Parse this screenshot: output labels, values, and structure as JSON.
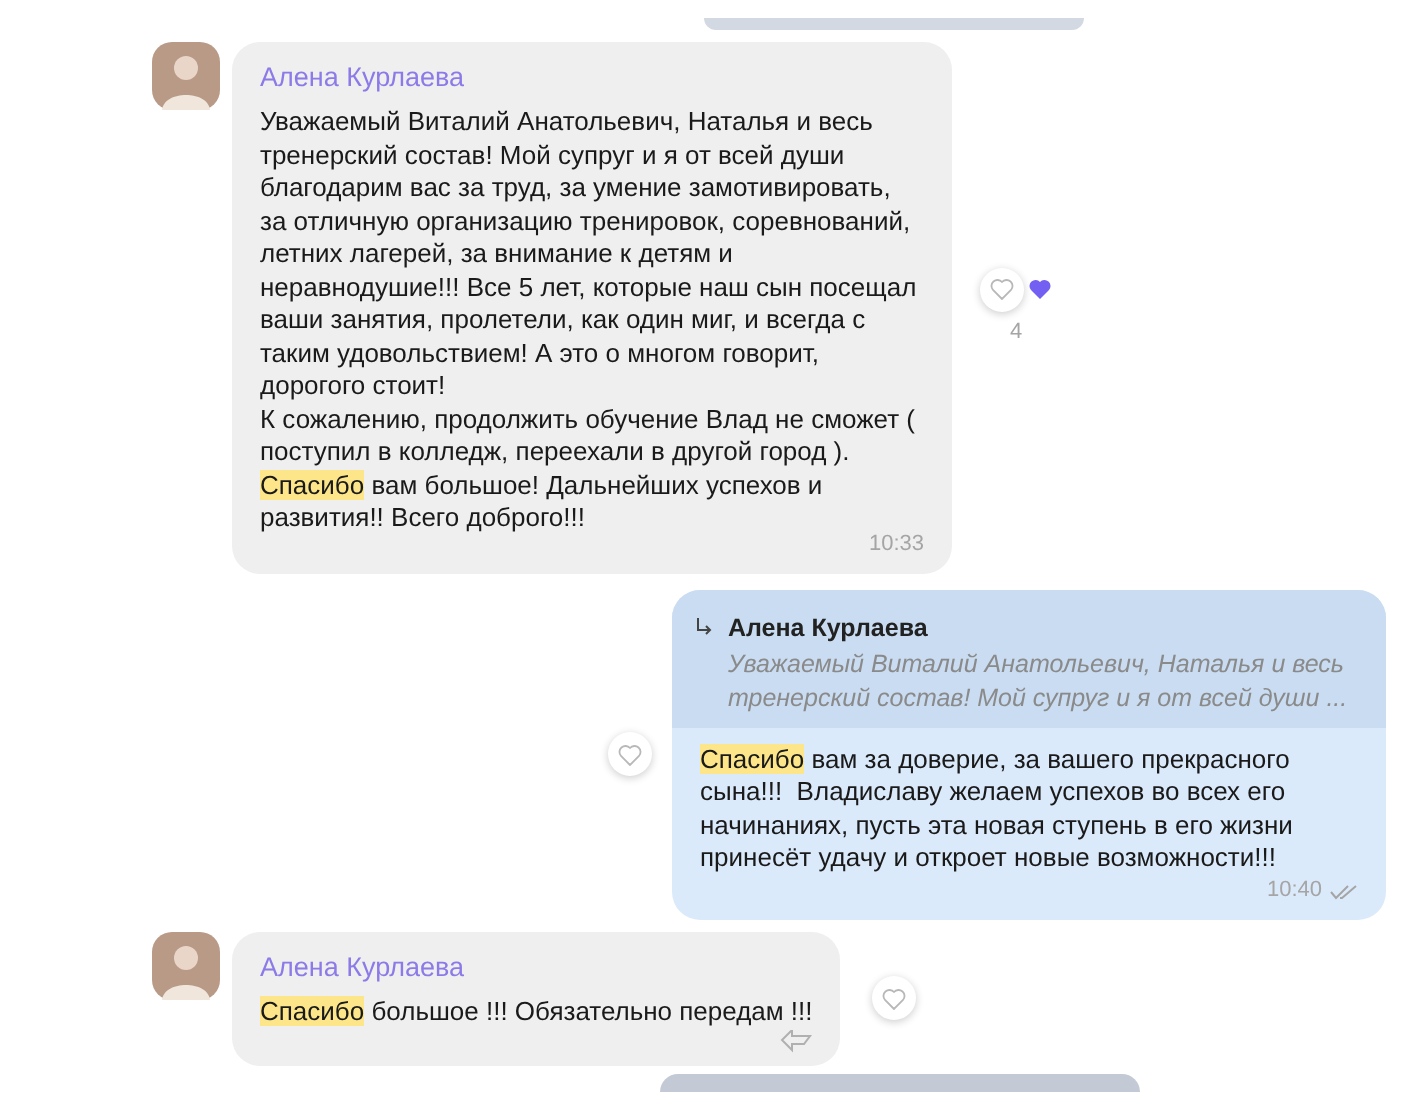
{
  "messages": [
    {
      "kind": "peek_top"
    },
    {
      "kind": "incoming",
      "author": "Алена Курлаева",
      "segments": [
        {
          "text": "Уважаемый Виталий Анатольевич, Наталья и весь тренерский состав! Мой супруг и я от всей души благодарим вас за труд, за умение замотивировать, за отличную организацию тренировок, соревнований, летних лагерей, за внимание к детям и неравнодушие!!! Все 5 лет, которые наш сын посещал ваши занятия, пролетели, как один миг, и всегда с таким удовольствием! А это о многом говорит, дорогого стоит!\nК сожалению, продолжить обучение Влад не сможет ( поступил в колледж, переехали в другой город ).\n",
          "highlighted": false
        },
        {
          "text": "Спасибо",
          "highlighted": true
        },
        {
          "text": " вам большое! Дальнейших успехов и развития!! Всего доброго!!!",
          "highlighted": false
        }
      ],
      "time": "10:33",
      "liked": false,
      "reaction_count": "4"
    },
    {
      "kind": "outgoing",
      "quote": {
        "author": "Алена Курлаева",
        "text": "Уважаемый Виталий Анатольевич, Наталья и весь тренерский состав! Мой супруг и я от всей души ..."
      },
      "segments": [
        {
          "text": "Спасибо",
          "highlighted": true
        },
        {
          "text": " вам за доверие, за вашего прекрасного сына!!!  Владиславу желаем успехов во всех его начинаниях, пусть эта новая ступень в его жизни принесёт удачу и откроет новые возможности!!!",
          "highlighted": false
        }
      ],
      "time": "10:40",
      "read": true,
      "liked": false
    },
    {
      "kind": "incoming",
      "author": "Алена Курлаева",
      "segments": [
        {
          "text": "Спасибо",
          "highlighted": true
        },
        {
          "text": " большое !!! Обязательно передам !!!",
          "highlighted": false
        }
      ],
      "liked": false,
      "replied": true
    },
    {
      "kind": "peek_bottom"
    }
  ]
}
